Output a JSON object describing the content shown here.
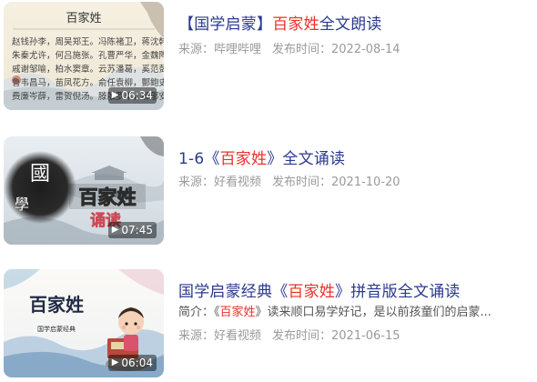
{
  "results": [
    {
      "title_pre": "【国学启蒙】",
      "title_hl": "百家姓",
      "title_post": "全文朗读",
      "source": "来源：哔哩哔哩",
      "date": "发布时间：2022-08-14",
      "duration": "06:34",
      "thumb_title": "百家姓",
      "thumb_text": "百家姓 赵钱孙李，周吴郑王。冯陈褚卫，蒋沈韩杨。朱秦尤许，何吕施张。孔曹严华，金魏陶姜。戚谢邹喻，柏水窦章。云苏潘葛，奚范彭郎。鲁韦昌马，苗凤花方。俞任袁柳"
    },
    {
      "title_pre": "1-6《",
      "title_hl": "百家姓",
      "title_post": "》全文诵读",
      "source": "来源：好看视频",
      "date": "发布时间：2021-10-20",
      "duration": "07:45",
      "thumb_logo": "國學",
      "thumb_title": "百家姓",
      "thumb_sub": "诵读"
    },
    {
      "title_pre": "国学启蒙经典《",
      "title_hl": "百家姓",
      "title_post": "》拼音版全文诵读",
      "desc_pre": "简介：《",
      "desc_hl": "百家姓",
      "desc_post": "》读来顺口易学好记，是以前孩童们的启蒙...",
      "source": "来源：好看视频",
      "date": "发布时间：2021-06-15",
      "duration": "06:04",
      "thumb_title": "百家姓",
      "thumb_sub": "国学启蒙经典"
    }
  ]
}
